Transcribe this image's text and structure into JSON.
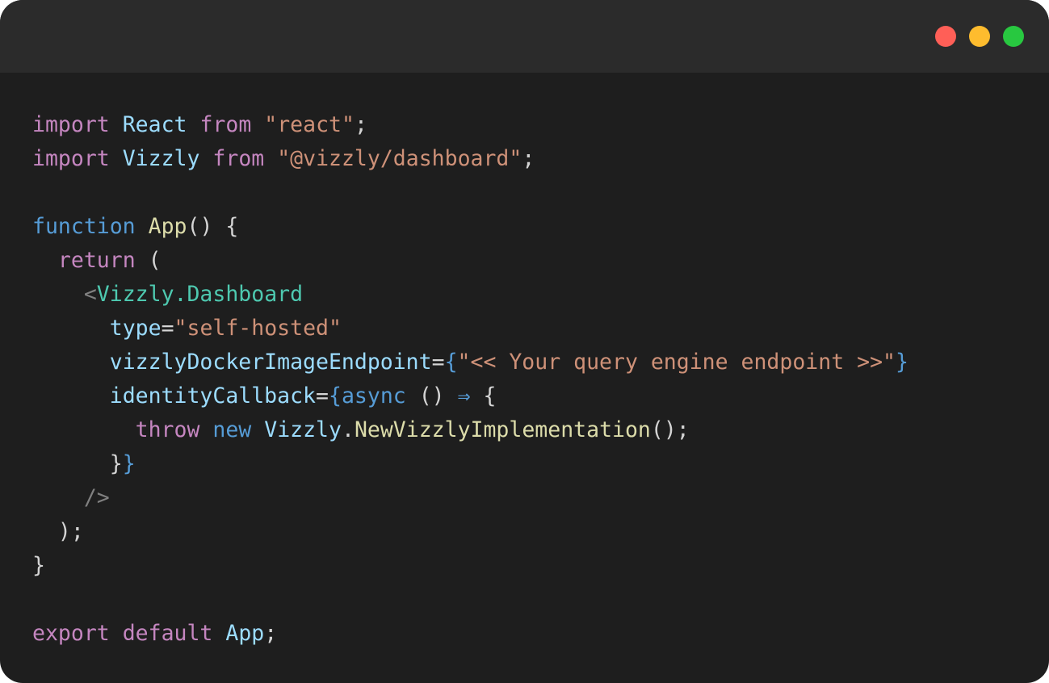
{
  "window": {
    "controls": [
      "close",
      "minimize",
      "maximize"
    ]
  },
  "colors": {
    "background": "#1e1e1e",
    "titlebar": "#2b2b2b",
    "close": "#ff5f57",
    "minimize": "#febc2e",
    "maximize": "#28c840"
  },
  "code": {
    "l1": {
      "kw1": "import",
      "id": "React",
      "kw2": "from",
      "str": "\"react\"",
      "end": ";"
    },
    "l2": {
      "kw1": "import",
      "id": "Vizzly",
      "kw2": "from",
      "str": "\"@vizzly/dashboard\"",
      "end": ";"
    },
    "l4": {
      "kw": "function",
      "fn": "App",
      "rest": "() {"
    },
    "l5": {
      "kw": "return",
      "rest": "("
    },
    "l6": {
      "lt": "<",
      "tag": "Vizzly.Dashboard"
    },
    "l7": {
      "attr": "type",
      "eq": "=",
      "str": "\"self-hosted\""
    },
    "l8": {
      "attr": "vizzlyDockerImageEndpoint",
      "eq": "=",
      "ob": "{",
      "str": "\"<< Your query engine endpoint >>\"",
      "cb": "}"
    },
    "l9": {
      "attr": "identityCallback",
      "eq": "=",
      "ob": "{",
      "kw": "async",
      "paren": "()",
      "arrow": "⇒",
      "brace": "{"
    },
    "l10": {
      "kw1": "throw",
      "kw2": "new",
      "id": "Vizzly",
      "dot": ".",
      "fn": "NewVizzlyImplementation",
      "end": "();"
    },
    "l11": {
      "close": "}",
      "cb": "}"
    },
    "l12": {
      "selfclose": "/>"
    },
    "l13": {
      "text": ");"
    },
    "l14": {
      "text": "}"
    },
    "l16": {
      "kw1": "export",
      "kw2": "default",
      "id": "App",
      "end": ";"
    }
  }
}
